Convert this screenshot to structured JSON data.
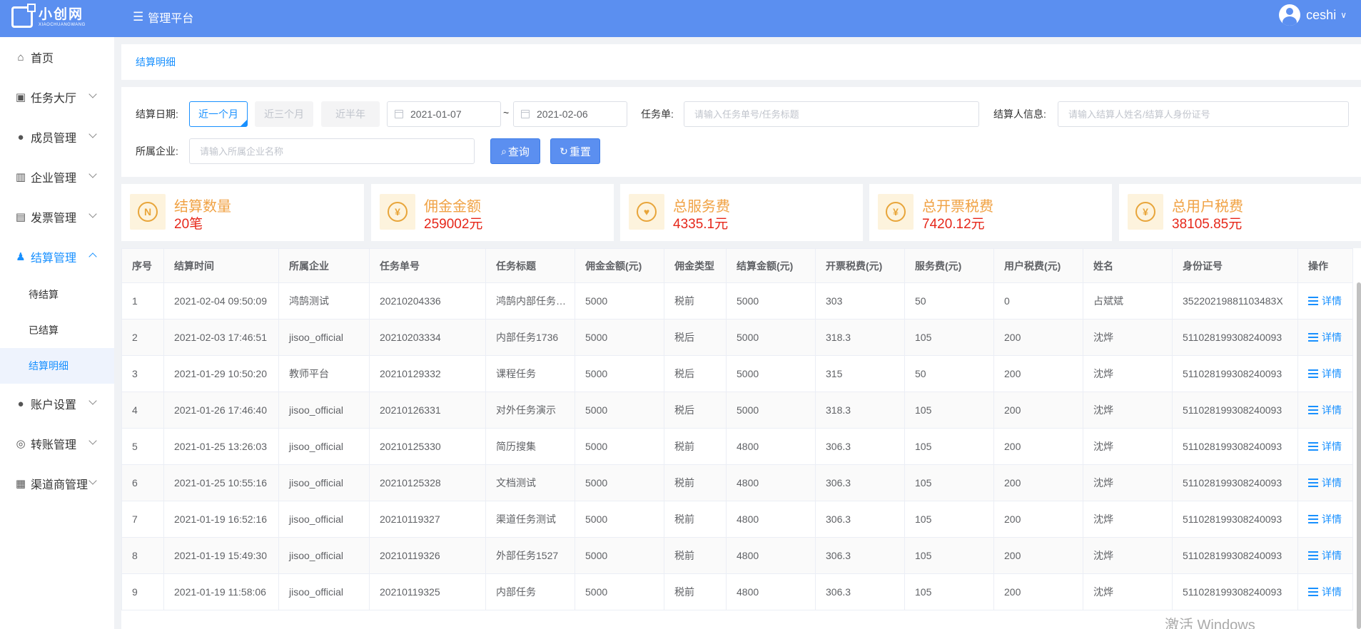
{
  "header": {
    "logo_cn": "小创网",
    "logo_en": "XIAOCHUANGWANG",
    "menu_title": "管理平台",
    "username": "ceshi"
  },
  "sidebar": {
    "items": [
      {
        "label": "首页"
      },
      {
        "label": "任务大厅"
      },
      {
        "label": "成员管理"
      },
      {
        "label": "企业管理"
      },
      {
        "label": "发票管理"
      },
      {
        "label": "结算管理"
      },
      {
        "label": "账户设置"
      },
      {
        "label": "转账管理"
      },
      {
        "label": "渠道商管理"
      }
    ],
    "sub_items": [
      {
        "label": "待结算"
      },
      {
        "label": "已结算"
      },
      {
        "label": "结算明细"
      }
    ]
  },
  "breadcrumb": "结算明细",
  "filter": {
    "date_label": "结算日期:",
    "range_buttons": [
      "近一个月",
      "近三个月",
      "近半年"
    ],
    "date_start": "2021-01-07",
    "date_sep": "~",
    "date_end": "2021-02-06",
    "task_label": "任务单:",
    "task_placeholder": "请输入任务单号/任务标题",
    "settler_label": "结算人信息:",
    "settler_placeholder": "请输入结算人姓名/结算人身份证号",
    "company_label": "所属企业:",
    "company_placeholder": "请输入所属企业名称",
    "query_btn": "查询",
    "reset_btn": "重置"
  },
  "stats": [
    {
      "title": "结算数量",
      "value": "20笔",
      "icon": "N"
    },
    {
      "title": "佣金金额",
      "value": "259002元",
      "icon": "¥"
    },
    {
      "title": "总服务费",
      "value": "4335.1元",
      "icon": "♥"
    },
    {
      "title": "总开票税费",
      "value": "7420.12元",
      "icon": "¥"
    },
    {
      "title": "总用户税费",
      "value": "38105.85元",
      "icon": "¥"
    }
  ],
  "table": {
    "headers": [
      "序号",
      "结算时间",
      "所属企业",
      "任务单号",
      "任务标题",
      "佣金金额(元)",
      "佣金类型",
      "结算金额(元)",
      "开票税费(元)",
      "服务费(元)",
      "用户税费(元)",
      "姓名",
      "身份证号",
      "操作"
    ],
    "action_label": "详情",
    "rows": [
      [
        "1",
        "2021-02-04 09:50:09",
        "鸿鹄测试",
        "20210204336",
        "鸿鹄内部任务测试",
        "5000",
        "税前",
        "5000",
        "303",
        "50",
        "0",
        "占斌斌",
        "35220219881103483X"
      ],
      [
        "2",
        "2021-02-03 17:46:51",
        "jisoo_official",
        "20210203334",
        "内部任务1736",
        "5000",
        "税后",
        "5000",
        "318.3",
        "105",
        "200",
        "沈烨",
        "511028199308240093"
      ],
      [
        "3",
        "2021-01-29 10:50:20",
        "教师平台",
        "20210129332",
        "课程任务",
        "5000",
        "税后",
        "5000",
        "315",
        "50",
        "200",
        "沈烨",
        "511028199308240093"
      ],
      [
        "4",
        "2021-01-26 17:46:40",
        "jisoo_official",
        "20210126331",
        "对外任务演示",
        "5000",
        "税后",
        "5000",
        "318.3",
        "105",
        "200",
        "沈烨",
        "511028199308240093"
      ],
      [
        "5",
        "2021-01-25 13:26:03",
        "jisoo_official",
        "20210125330",
        "简历搜集",
        "5000",
        "税前",
        "4800",
        "306.3",
        "105",
        "200",
        "沈烨",
        "511028199308240093"
      ],
      [
        "6",
        "2021-01-25 10:55:16",
        "jisoo_official",
        "20210125328",
        "文档测试",
        "5000",
        "税前",
        "4800",
        "306.3",
        "105",
        "200",
        "沈烨",
        "511028199308240093"
      ],
      [
        "7",
        "2021-01-19 16:52:16",
        "jisoo_official",
        "20210119327",
        "渠道任务测试",
        "5000",
        "税前",
        "4800",
        "306.3",
        "105",
        "200",
        "沈烨",
        "511028199308240093"
      ],
      [
        "8",
        "2021-01-19 15:49:30",
        "jisoo_official",
        "20210119326",
        "外部任务1527",
        "5000",
        "税前",
        "4800",
        "306.3",
        "105",
        "200",
        "沈烨",
        "511028199308240093"
      ],
      [
        "9",
        "2021-01-19 11:58:06",
        "jisoo_official",
        "20210119325",
        "内部任务",
        "5000",
        "税前",
        "4800",
        "306.3",
        "105",
        "200",
        "沈烨",
        "511028199308240093"
      ]
    ]
  },
  "watermark": "激活 Windows"
}
